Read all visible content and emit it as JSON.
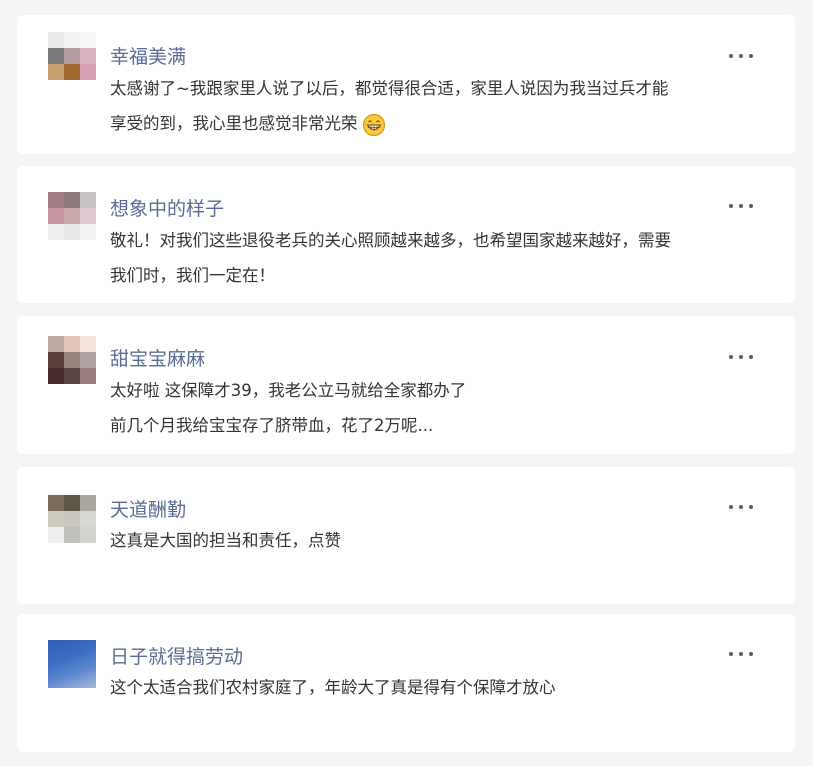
{
  "comments": [
    {
      "name": "幸福美满",
      "lines": [
        "太感谢了~我跟家里人说了以后，都觉得很合适，家里人说因为我当过兵才能",
        "享受的到，我心里也感觉非常光荣"
      ],
      "emoji": "grinning-face-emoji",
      "avatar_colors": [
        "#e9e9e9",
        "#f3f3f3",
        "#f8f8f8",
        "#7b7a79",
        "#b59a9f",
        "#d9b0c0",
        "#c7a070",
        "#a06a2e",
        "#d89eb3",
        "#efe1d2",
        "#e8d7c4",
        "#f4ecec"
      ]
    },
    {
      "name": "想象中的样子",
      "lines": [
        "敬礼！对我们这些退役老兵的关心照顾越来越多，也希望国家越来越好，需要",
        "我们时，我们一定在！"
      ],
      "avatar_colors": [
        "#a27d85",
        "#8e7b7e",
        "#c6c1c2",
        "#c798a4",
        "#c9a9aa",
        "#dfc8d0",
        "#eeeeee",
        "#e7e7e7",
        "#f2f2f2"
      ]
    },
    {
      "name": "甜宝宝麻麻",
      "lines": [
        "太好啦 这保障才39，我老公立马就给全家都办了",
        "前几个月我给宝宝存了脐带血，花了2万呢..."
      ],
      "avatar_colors": [
        "#bfa9a0",
        "#e5c5b5",
        "#f6e4dc",
        "#5b3d38",
        "#9a847e",
        "#b1a3a1",
        "#4a2b2d",
        "#5b4242",
        "#9a7e80"
      ]
    },
    {
      "name": "天道酬勤",
      "lines": [
        "这真是大国的担当和责任，点赞"
      ],
      "avatar_colors": [
        "#7b6c59",
        "#5e5647",
        "#a9a79f",
        "#cfcbbf",
        "#c9c7bd",
        "#d9d8d2",
        "#eeeeee",
        "#c0bfbb",
        "#d2d2cf"
      ]
    },
    {
      "name": "日子就得搞劳动",
      "lines": [
        "这个太适合我们农村家庭了，年龄大了真是得有个保障才放心"
      ],
      "avatar_colors": [
        "#2d5fb8",
        "#5b86cf",
        "#a9b9d6"
      ]
    }
  ]
}
